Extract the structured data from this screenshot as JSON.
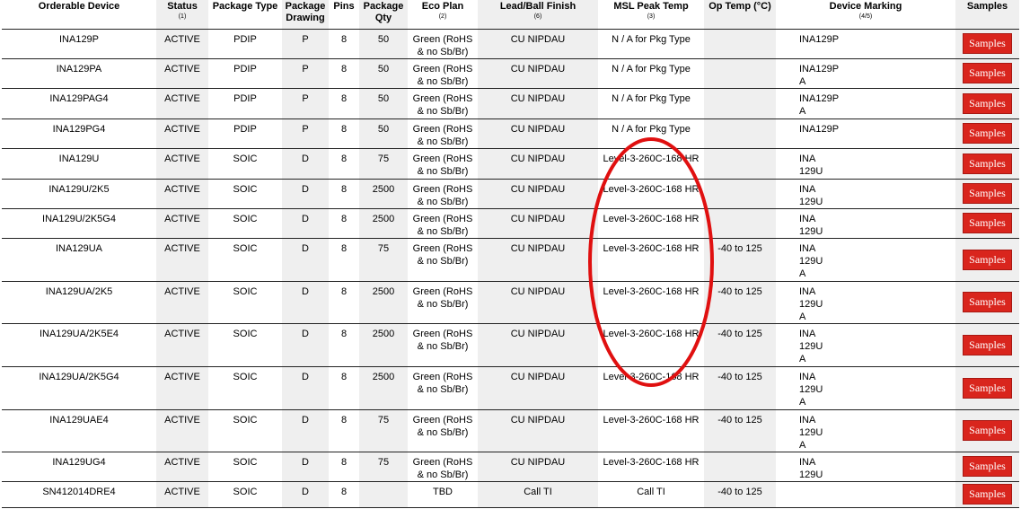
{
  "headers": {
    "device": "Orderable Device",
    "status": "Status",
    "status_note": "(1)",
    "pkg_type": "Package Type",
    "pkg_drawing": "Package Drawing",
    "pins": "Pins",
    "pkg_qty": "Package Qty",
    "eco": "Eco Plan",
    "eco_note": "(2)",
    "lead": "Lead/Ball Finish",
    "lead_note": "(6)",
    "msl": "MSL Peak Temp",
    "msl_note": "(3)",
    "optemp": "Op Temp (°C)",
    "marking": "Device Marking",
    "marking_note": "(4/5)",
    "samples": "Samples"
  },
  "sample_label": "Samples",
  "colors": {
    "sample_button": "#d9251d",
    "annotation": "#e01010",
    "shaded_column": "#efefef"
  },
  "annotation": {
    "shape": "ellipse",
    "around": "MSL Peak Temp Level-3 rows"
  },
  "rows": [
    {
      "device": "INA129P",
      "status": "ACTIVE",
      "pkg": "PDIP",
      "drawing": "P",
      "pins": "8",
      "qty": "50",
      "eco": [
        "Green (RoHS",
        "& no Sb/Br)"
      ],
      "lead": "CU NIPDAU",
      "msl": "N / A for Pkg Type",
      "optemp": "",
      "marking": [
        "INA129P"
      ]
    },
    {
      "device": "INA129PA",
      "status": "ACTIVE",
      "pkg": "PDIP",
      "drawing": "P",
      "pins": "8",
      "qty": "50",
      "eco": [
        "Green (RoHS",
        "& no Sb/Br)"
      ],
      "lead": "CU NIPDAU",
      "msl": "N / A for Pkg Type",
      "optemp": "",
      "marking": [
        "INA129P",
        "A"
      ]
    },
    {
      "device": "INA129PAG4",
      "status": "ACTIVE",
      "pkg": "PDIP",
      "drawing": "P",
      "pins": "8",
      "qty": "50",
      "eco": [
        "Green (RoHS",
        "& no Sb/Br)"
      ],
      "lead": "CU NIPDAU",
      "msl": "N / A for Pkg Type",
      "optemp": "",
      "marking": [
        "INA129P",
        "A"
      ]
    },
    {
      "device": "INA129PG4",
      "status": "ACTIVE",
      "pkg": "PDIP",
      "drawing": "P",
      "pins": "8",
      "qty": "50",
      "eco": [
        "Green (RoHS",
        "& no Sb/Br)"
      ],
      "lead": "CU NIPDAU",
      "msl": "N / A for Pkg Type",
      "optemp": "",
      "marking": [
        "INA129P"
      ]
    },
    {
      "device": "INA129U",
      "status": "ACTIVE",
      "pkg": "SOIC",
      "drawing": "D",
      "pins": "8",
      "qty": "75",
      "eco": [
        "Green (RoHS",
        "& no Sb/Br)"
      ],
      "lead": "CU NIPDAU",
      "msl": "Level-3-260C-168 HR",
      "optemp": "",
      "marking": [
        "INA",
        "129U"
      ]
    },
    {
      "device": "INA129U/2K5",
      "status": "ACTIVE",
      "pkg": "SOIC",
      "drawing": "D",
      "pins": "8",
      "qty": "2500",
      "eco": [
        "Green (RoHS",
        "& no Sb/Br)"
      ],
      "lead": "CU NIPDAU",
      "msl": "Level-3-260C-168 HR",
      "optemp": "",
      "marking": [
        "INA",
        "129U"
      ]
    },
    {
      "device": "INA129U/2K5G4",
      "status": "ACTIVE",
      "pkg": "SOIC",
      "drawing": "D",
      "pins": "8",
      "qty": "2500",
      "eco": [
        "Green (RoHS",
        "& no Sb/Br)"
      ],
      "lead": "CU NIPDAU",
      "msl": "Level-3-260C-168 HR",
      "optemp": "",
      "marking": [
        "INA",
        "129U"
      ]
    },
    {
      "device": "INA129UA",
      "status": "ACTIVE",
      "pkg": "SOIC",
      "drawing": "D",
      "pins": "8",
      "qty": "75",
      "eco": [
        "Green (RoHS",
        "& no Sb/Br)"
      ],
      "lead": "CU NIPDAU",
      "msl": "Level-3-260C-168 HR",
      "optemp": "-40 to 125",
      "marking": [
        "INA",
        "129U",
        "A"
      ]
    },
    {
      "device": "INA129UA/2K5",
      "status": "ACTIVE",
      "pkg": "SOIC",
      "drawing": "D",
      "pins": "8",
      "qty": "2500",
      "eco": [
        "Green (RoHS",
        "& no Sb/Br)"
      ],
      "lead": "CU NIPDAU",
      "msl": "Level-3-260C-168 HR",
      "optemp": "-40 to 125",
      "marking": [
        "INA",
        "129U",
        "A"
      ]
    },
    {
      "device": "INA129UA/2K5E4",
      "status": "ACTIVE",
      "pkg": "SOIC",
      "drawing": "D",
      "pins": "8",
      "qty": "2500",
      "eco": [
        "Green (RoHS",
        "& no Sb/Br)"
      ],
      "lead": "CU NIPDAU",
      "msl": "Level-3-260C-168 HR",
      "optemp": "-40 to 125",
      "marking": [
        "INA",
        "129U",
        "A"
      ]
    },
    {
      "device": "INA129UA/2K5G4",
      "status": "ACTIVE",
      "pkg": "SOIC",
      "drawing": "D",
      "pins": "8",
      "qty": "2500",
      "eco": [
        "Green (RoHS",
        "& no Sb/Br)"
      ],
      "lead": "CU NIPDAU",
      "msl": "Level-3-260C-168 HR",
      "optemp": "-40 to 125",
      "marking": [
        "INA",
        "129U",
        "A"
      ]
    },
    {
      "device": "INA129UAE4",
      "status": "ACTIVE",
      "pkg": "SOIC",
      "drawing": "D",
      "pins": "8",
      "qty": "75",
      "eco": [
        "Green (RoHS",
        "& no Sb/Br)"
      ],
      "lead": "CU NIPDAU",
      "msl": "Level-3-260C-168 HR",
      "optemp": "-40 to 125",
      "marking": [
        "INA",
        "129U",
        "A"
      ]
    },
    {
      "device": "INA129UG4",
      "status": "ACTIVE",
      "pkg": "SOIC",
      "drawing": "D",
      "pins": "8",
      "qty": "75",
      "eco": [
        "Green (RoHS",
        "& no Sb/Br)"
      ],
      "lead": "CU NIPDAU",
      "msl": "Level-3-260C-168 HR",
      "optemp": "",
      "marking": [
        "INA",
        "129U"
      ]
    },
    {
      "device": "SN412014DRE4",
      "status": "ACTIVE",
      "pkg": "SOIC",
      "drawing": "D",
      "pins": "8",
      "qty": "",
      "eco": [
        "TBD"
      ],
      "lead": "Call TI",
      "msl": "Call TI",
      "optemp": "-40 to 125",
      "marking": []
    }
  ]
}
